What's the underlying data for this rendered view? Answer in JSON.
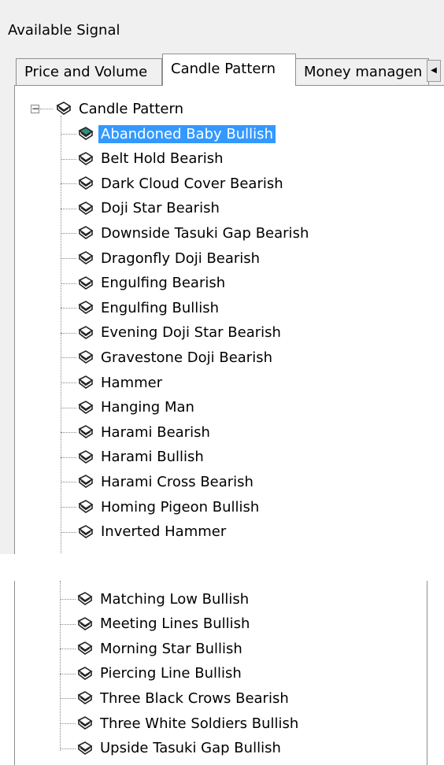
{
  "header": {
    "label": "Available Signal"
  },
  "tabs": [
    {
      "label": "Price and Volume"
    },
    {
      "label": "Candle Pattern"
    },
    {
      "label": "Money managen"
    }
  ],
  "tree": {
    "root_label": "Candle Pattern",
    "items_top": [
      {
        "label": "Abandoned Baby Bullish",
        "selected": true
      },
      {
        "label": "Belt Hold Bearish"
      },
      {
        "label": "Dark Cloud Cover Bearish"
      },
      {
        "label": "Doji Star Bearish"
      },
      {
        "label": "Downside Tasuki Gap Bearish"
      },
      {
        "label": "Dragonfly Doji Bearish"
      },
      {
        "label": "Engulfing Bearish"
      },
      {
        "label": "Engulfing Bullish"
      },
      {
        "label": "Evening Doji Star Bearish"
      },
      {
        "label": "Gravestone Doji Bearish"
      },
      {
        "label": "Hammer"
      },
      {
        "label": "Hanging Man"
      },
      {
        "label": "Harami Bearish"
      },
      {
        "label": "Harami Bullish"
      },
      {
        "label": "Harami Cross Bearish"
      },
      {
        "label": "Homing Pigeon Bullish"
      },
      {
        "label": "Inverted Hammer"
      }
    ],
    "items_bottom": [
      {
        "label": "Matching Low Bullish"
      },
      {
        "label": "Meeting Lines Bullish"
      },
      {
        "label": "Morning Star Bullish"
      },
      {
        "label": "Piercing Line Bullish"
      },
      {
        "label": "Three Black Crows Bearish"
      },
      {
        "label": "Three White Soldiers Bullish"
      },
      {
        "label": "Upside Tasuki Gap Bullish"
      }
    ]
  },
  "colors": {
    "selection": "#3399ff",
    "panel": "#f0f0f0"
  }
}
